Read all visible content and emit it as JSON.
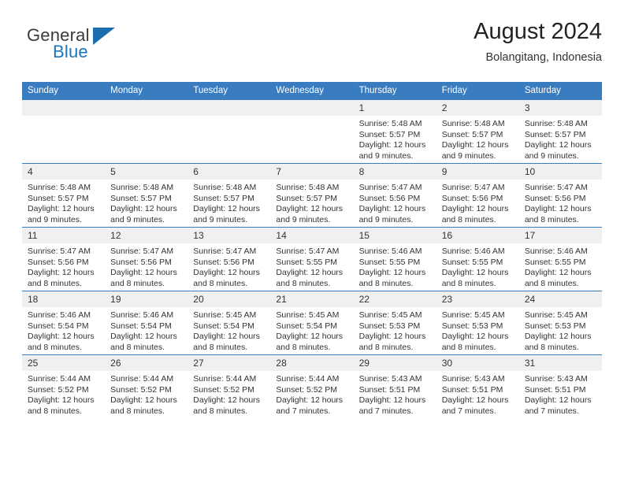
{
  "brand": {
    "word1": "General",
    "word2": "Blue",
    "accent_color": "#1b75bb",
    "triangle_color": "#1b6cb0"
  },
  "header": {
    "title": "August 2024",
    "subtitle": "Bolangitang, Indonesia"
  },
  "calendar": {
    "header_bg": "#3a7cc0",
    "daynum_bg": "#f0f0f0",
    "weekdays": [
      "Sunday",
      "Monday",
      "Tuesday",
      "Wednesday",
      "Thursday",
      "Friday",
      "Saturday"
    ],
    "weeks": [
      [
        {
          "day": "",
          "lines": []
        },
        {
          "day": "",
          "lines": []
        },
        {
          "day": "",
          "lines": []
        },
        {
          "day": "",
          "lines": []
        },
        {
          "day": "1",
          "lines": [
            "Sunrise: 5:48 AM",
            "Sunset: 5:57 PM",
            "Daylight: 12 hours",
            "and 9 minutes."
          ]
        },
        {
          "day": "2",
          "lines": [
            "Sunrise: 5:48 AM",
            "Sunset: 5:57 PM",
            "Daylight: 12 hours",
            "and 9 minutes."
          ]
        },
        {
          "day": "3",
          "lines": [
            "Sunrise: 5:48 AM",
            "Sunset: 5:57 PM",
            "Daylight: 12 hours",
            "and 9 minutes."
          ]
        }
      ],
      [
        {
          "day": "4",
          "lines": [
            "Sunrise: 5:48 AM",
            "Sunset: 5:57 PM",
            "Daylight: 12 hours",
            "and 9 minutes."
          ]
        },
        {
          "day": "5",
          "lines": [
            "Sunrise: 5:48 AM",
            "Sunset: 5:57 PM",
            "Daylight: 12 hours",
            "and 9 minutes."
          ]
        },
        {
          "day": "6",
          "lines": [
            "Sunrise: 5:48 AM",
            "Sunset: 5:57 PM",
            "Daylight: 12 hours",
            "and 9 minutes."
          ]
        },
        {
          "day": "7",
          "lines": [
            "Sunrise: 5:48 AM",
            "Sunset: 5:57 PM",
            "Daylight: 12 hours",
            "and 9 minutes."
          ]
        },
        {
          "day": "8",
          "lines": [
            "Sunrise: 5:47 AM",
            "Sunset: 5:56 PM",
            "Daylight: 12 hours",
            "and 9 minutes."
          ]
        },
        {
          "day": "9",
          "lines": [
            "Sunrise: 5:47 AM",
            "Sunset: 5:56 PM",
            "Daylight: 12 hours",
            "and 8 minutes."
          ]
        },
        {
          "day": "10",
          "lines": [
            "Sunrise: 5:47 AM",
            "Sunset: 5:56 PM",
            "Daylight: 12 hours",
            "and 8 minutes."
          ]
        }
      ],
      [
        {
          "day": "11",
          "lines": [
            "Sunrise: 5:47 AM",
            "Sunset: 5:56 PM",
            "Daylight: 12 hours",
            "and 8 minutes."
          ]
        },
        {
          "day": "12",
          "lines": [
            "Sunrise: 5:47 AM",
            "Sunset: 5:56 PM",
            "Daylight: 12 hours",
            "and 8 minutes."
          ]
        },
        {
          "day": "13",
          "lines": [
            "Sunrise: 5:47 AM",
            "Sunset: 5:56 PM",
            "Daylight: 12 hours",
            "and 8 minutes."
          ]
        },
        {
          "day": "14",
          "lines": [
            "Sunrise: 5:47 AM",
            "Sunset: 5:55 PM",
            "Daylight: 12 hours",
            "and 8 minutes."
          ]
        },
        {
          "day": "15",
          "lines": [
            "Sunrise: 5:46 AM",
            "Sunset: 5:55 PM",
            "Daylight: 12 hours",
            "and 8 minutes."
          ]
        },
        {
          "day": "16",
          "lines": [
            "Sunrise: 5:46 AM",
            "Sunset: 5:55 PM",
            "Daylight: 12 hours",
            "and 8 minutes."
          ]
        },
        {
          "day": "17",
          "lines": [
            "Sunrise: 5:46 AM",
            "Sunset: 5:55 PM",
            "Daylight: 12 hours",
            "and 8 minutes."
          ]
        }
      ],
      [
        {
          "day": "18",
          "lines": [
            "Sunrise: 5:46 AM",
            "Sunset: 5:54 PM",
            "Daylight: 12 hours",
            "and 8 minutes."
          ]
        },
        {
          "day": "19",
          "lines": [
            "Sunrise: 5:46 AM",
            "Sunset: 5:54 PM",
            "Daylight: 12 hours",
            "and 8 minutes."
          ]
        },
        {
          "day": "20",
          "lines": [
            "Sunrise: 5:45 AM",
            "Sunset: 5:54 PM",
            "Daylight: 12 hours",
            "and 8 minutes."
          ]
        },
        {
          "day": "21",
          "lines": [
            "Sunrise: 5:45 AM",
            "Sunset: 5:54 PM",
            "Daylight: 12 hours",
            "and 8 minutes."
          ]
        },
        {
          "day": "22",
          "lines": [
            "Sunrise: 5:45 AM",
            "Sunset: 5:53 PM",
            "Daylight: 12 hours",
            "and 8 minutes."
          ]
        },
        {
          "day": "23",
          "lines": [
            "Sunrise: 5:45 AM",
            "Sunset: 5:53 PM",
            "Daylight: 12 hours",
            "and 8 minutes."
          ]
        },
        {
          "day": "24",
          "lines": [
            "Sunrise: 5:45 AM",
            "Sunset: 5:53 PM",
            "Daylight: 12 hours",
            "and 8 minutes."
          ]
        }
      ],
      [
        {
          "day": "25",
          "lines": [
            "Sunrise: 5:44 AM",
            "Sunset: 5:52 PM",
            "Daylight: 12 hours",
            "and 8 minutes."
          ]
        },
        {
          "day": "26",
          "lines": [
            "Sunrise: 5:44 AM",
            "Sunset: 5:52 PM",
            "Daylight: 12 hours",
            "and 8 minutes."
          ]
        },
        {
          "day": "27",
          "lines": [
            "Sunrise: 5:44 AM",
            "Sunset: 5:52 PM",
            "Daylight: 12 hours",
            "and 8 minutes."
          ]
        },
        {
          "day": "28",
          "lines": [
            "Sunrise: 5:44 AM",
            "Sunset: 5:52 PM",
            "Daylight: 12 hours",
            "and 7 minutes."
          ]
        },
        {
          "day": "29",
          "lines": [
            "Sunrise: 5:43 AM",
            "Sunset: 5:51 PM",
            "Daylight: 12 hours",
            "and 7 minutes."
          ]
        },
        {
          "day": "30",
          "lines": [
            "Sunrise: 5:43 AM",
            "Sunset: 5:51 PM",
            "Daylight: 12 hours",
            "and 7 minutes."
          ]
        },
        {
          "day": "31",
          "lines": [
            "Sunrise: 5:43 AM",
            "Sunset: 5:51 PM",
            "Daylight: 12 hours",
            "and 7 minutes."
          ]
        }
      ]
    ]
  }
}
